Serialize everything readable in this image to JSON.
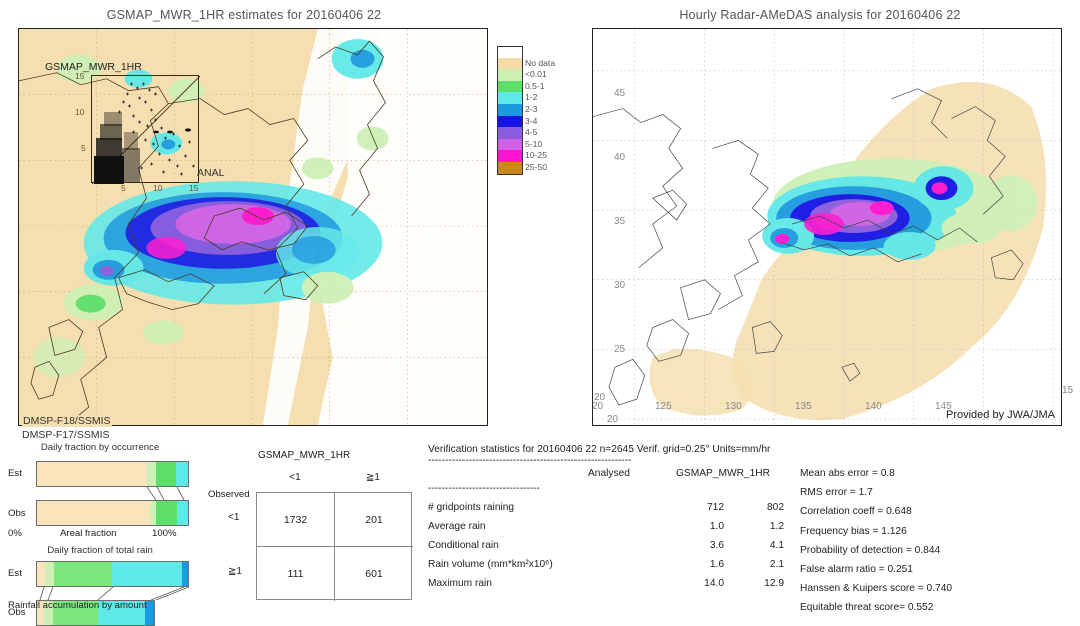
{
  "left_panel": {
    "title": "GSMAP_MWR_1HR estimates for 20160406 22",
    "inset_title": "GSMAP_MWR_1HR",
    "inset_ticks": [
      "15",
      "10",
      "5",
      "5",
      "10",
      "15"
    ],
    "anal_label": "ANAL",
    "sensor_1": "DMSP-F18/SSMIS",
    "sensor_2": "DMSP-F17/SSMIS"
  },
  "right_panel": {
    "title": "Hourly Radar-AMeDAS analysis for 20160406 22",
    "credit": "Provided by JWA/JMA",
    "x_ticks": [
      "20",
      "125",
      "130",
      "135",
      "140",
      "145",
      "15"
    ],
    "y_ticks": [
      "45",
      "40",
      "35",
      "30",
      "25",
      "20"
    ],
    "corner_tick": "20"
  },
  "colorbar": {
    "entries": [
      {
        "label": "",
        "color": "#ffffff"
      },
      {
        "label": "No data",
        "color": "#f5d9a8"
      },
      {
        "label": "<0.01",
        "color": "#ccf0b4"
      },
      {
        "label": "0.5-1",
        "color": "#5ce06a"
      },
      {
        "label": "1-2",
        "color": "#5fe8e8"
      },
      {
        "label": "2-3",
        "color": "#1b9ae0"
      },
      {
        "label": "3-4",
        "color": "#1414e6"
      },
      {
        "label": "4-5",
        "color": "#8a5ce0"
      },
      {
        "label": "5-10",
        "color": "#d060e8"
      },
      {
        "label": "10-25",
        "color": "#ff14d2"
      },
      {
        "label": "25-50",
        "color": "#c8881e"
      }
    ]
  },
  "barcharts": [
    {
      "title": "Daily fraction by occurrence",
      "axis_left": "0%",
      "axis_center": "Areal fraction",
      "axis_right": "100%",
      "rows": [
        {
          "label": "Est",
          "width_pct": 100,
          "segments": [
            {
              "color": "#f9e3bb",
              "pct": 73
            },
            {
              "color": "#cdf0b6",
              "pct": 6
            },
            {
              "color": "#5ce06a",
              "pct": 13
            },
            {
              "color": "#5fe8e8",
              "pct": 8
            }
          ]
        },
        {
          "label": "Obs",
          "width_pct": 100,
          "segments": [
            {
              "color": "#f9e3bb",
              "pct": 75
            },
            {
              "color": "#cdf0b6",
              "pct": 4
            },
            {
              "color": "#5ce06a",
              "pct": 14
            },
            {
              "color": "#5fe8e8",
              "pct": 7
            }
          ]
        }
      ]
    },
    {
      "title": "Daily fraction of total rain",
      "caption": "Rainfall accumulation by amount",
      "rows": [
        {
          "label": "Est",
          "width_pct": 100,
          "segments": [
            {
              "color": "#f9e3bb",
              "pct": 5
            },
            {
              "color": "#cdf0b6",
              "pct": 6
            },
            {
              "color": "#7ce87c",
              "pct": 39
            },
            {
              "color": "#5fe8e8",
              "pct": 46
            },
            {
              "color": "#1b9ae0",
              "pct": 4
            }
          ]
        },
        {
          "label": "Obs",
          "width_pct": 78,
          "segments": [
            {
              "color": "#f9e3bb",
              "pct": 6
            },
            {
              "color": "#cdf0b6",
              "pct": 8
            },
            {
              "color": "#7ce87c",
              "pct": 38
            },
            {
              "color": "#5fe8e8",
              "pct": 40
            },
            {
              "color": "#1b9ae0",
              "pct": 8
            }
          ]
        }
      ]
    }
  ],
  "contingency": {
    "title": "GSMAP_MWR_1HR",
    "col_headers": [
      "<1",
      "≧1"
    ],
    "row_axis_label": "Observed",
    "row_headers": [
      "<1",
      "≧1"
    ],
    "cells": [
      [
        "1732",
        "201"
      ],
      [
        "111",
        "601"
      ]
    ]
  },
  "verification": {
    "header": "Verification statistics for 20160406 22  n=2645  Verif. grid=0.25°  Units=mm/hr",
    "divider": "------------------------------------------------------------",
    "sub_col1": "Analysed",
    "sub_col2": "GSMAP_MWR_1HR",
    "sub_divider": "---------------------------------",
    "rows": [
      {
        "name": "# gridpoints raining",
        "analysed": "712",
        "estimate": "802"
      },
      {
        "name": "Average rain",
        "analysed": "1.0",
        "estimate": "1.2"
      },
      {
        "name": "Conditional rain",
        "analysed": "3.6",
        "estimate": "4.1"
      },
      {
        "name": "Rain volume (mm*km²x10⁶)",
        "analysed": "1.6",
        "estimate": "2.1"
      },
      {
        "name": "Maximum rain",
        "analysed": "14.0",
        "estimate": "12.9"
      }
    ],
    "scores": [
      "Mean abs error = 0.8",
      "RMS error = 1.7",
      "Correlation coeff = 0.648",
      "Frequency bias = 1.126",
      "Probability of detection = 0.844",
      "False alarm ratio = 0.251",
      "Hanssen & Kuipers score = 0.740",
      "Equitable threat score= 0.552"
    ]
  },
  "chart_data": {
    "type": "bar",
    "title": "Daily fraction by occurrence / of total rain",
    "charts": [
      {
        "title": "Daily fraction by occurrence",
        "xlabel": "Areal fraction",
        "xlim": [
          0,
          100
        ],
        "categories": [
          "Est",
          "Obs"
        ],
        "series": [
          {
            "name": "No data / no rain",
            "values": [
              73,
              75
            ],
            "color": "#f9e3bb"
          },
          {
            "name": "<0.01",
            "values": [
              6,
              4
            ],
            "color": "#cdf0b6"
          },
          {
            "name": "0.5-1",
            "values": [
              13,
              14
            ],
            "color": "#5ce06a"
          },
          {
            "name": "1-2",
            "values": [
              8,
              7
            ],
            "color": "#5fe8e8"
          }
        ]
      },
      {
        "title": "Daily fraction of total rain",
        "xlabel": "Rainfall accumulation by amount",
        "xlim": [
          0,
          100
        ],
        "categories": [
          "Est",
          "Obs"
        ],
        "series": [
          {
            "name": "<0.01",
            "values": [
              5,
              5
            ],
            "color": "#f9e3bb"
          },
          {
            "name": "0.5-1",
            "values": [
              6,
              6
            ],
            "color": "#cdf0b6"
          },
          {
            "name": "1-2",
            "values": [
              39,
              30
            ],
            "color": "#7ce87c"
          },
          {
            "name": "2-3",
            "values": [
              46,
              31
            ],
            "color": "#5fe8e8"
          },
          {
            "name": "3-4",
            "values": [
              4,
              6
            ],
            "color": "#1b9ae0"
          }
        ]
      }
    ],
    "contingency_table": {
      "type": "table",
      "row_labels": [
        "Observed <1",
        "Observed ≧1"
      ],
      "col_labels": [
        "GSMAP_MWR_1HR <1",
        "GSMAP_MWR_1HR ≧1"
      ],
      "values": [
        [
          1732,
          201
        ],
        [
          111,
          601
        ]
      ]
    },
    "statistics": {
      "n": 2645,
      "verif_grid_deg": 0.25,
      "units": "mm/hr",
      "gridpoints_raining": {
        "analysed": 712,
        "estimate": 802
      },
      "average_rain": {
        "analysed": 1.0,
        "estimate": 1.2
      },
      "conditional_rain": {
        "analysed": 3.6,
        "estimate": 4.1
      },
      "rain_volume": {
        "analysed": 1.6,
        "estimate": 2.1
      },
      "maximum_rain": {
        "analysed": 14.0,
        "estimate": 12.9
      },
      "mean_abs_error": 0.8,
      "rms_error": 1.7,
      "correlation_coeff": 0.648,
      "frequency_bias": 1.126,
      "probability_of_detection": 0.844,
      "false_alarm_ratio": 0.251,
      "hanssen_kuipers_score": 0.74,
      "equitable_threat_score": 0.552
    }
  }
}
